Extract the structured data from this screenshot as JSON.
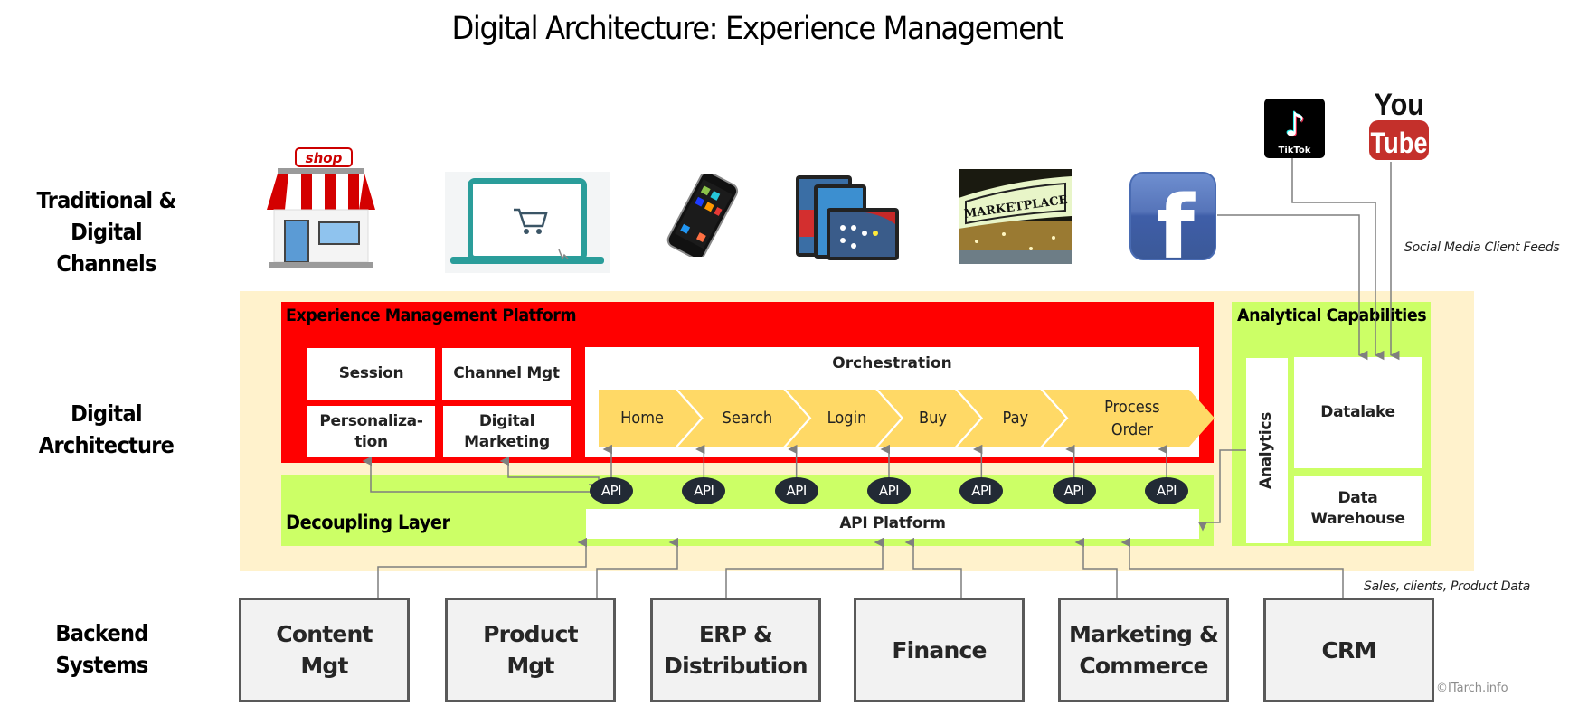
{
  "title": "Digital Architecture: Experience Management",
  "row_labels": {
    "channels": [
      "Traditional &",
      "Digital Channels"
    ],
    "architecture": [
      "Digital",
      "Architecture"
    ],
    "backend": [
      "Backend",
      "Systems"
    ]
  },
  "channels": [
    {
      "name": "store",
      "icon": "shop-storefront-icon",
      "sign": "shop"
    },
    {
      "name": "ecommerce",
      "icon": "laptop-shopping-cart-icon"
    },
    {
      "name": "mobile",
      "icon": "smartphone-icon"
    },
    {
      "name": "tablets",
      "icon": "tablet-devices-icon"
    },
    {
      "name": "marketplace",
      "icon": "marketplace-sign-icon",
      "sign": "MARKETPLACE"
    },
    {
      "name": "facebook",
      "icon": "facebook-icon",
      "glyph": "f"
    },
    {
      "name": "tiktok",
      "icon": "tiktok-icon",
      "label": "TikTok"
    },
    {
      "name": "youtube",
      "icon": "youtube-icon",
      "label_top": "You",
      "label_bottom": "Tube"
    }
  ],
  "social_feeds_note": "Social Media Client Feeds",
  "experience_platform": {
    "title": "Experience Management Platform",
    "modules": {
      "session": "Session",
      "channel_mgt": "Channel Mgt",
      "personalization": [
        "Personaliza-",
        "tion"
      ],
      "digital_marketing": [
        "Digital",
        "Marketing"
      ]
    },
    "orchestration": {
      "title": "Orchestration",
      "steps": [
        {
          "label": [
            "Home"
          ]
        },
        {
          "label": [
            "Search"
          ]
        },
        {
          "label": [
            "Login"
          ]
        },
        {
          "label": [
            "Buy"
          ]
        },
        {
          "label": [
            "Pay"
          ]
        },
        {
          "label": [
            "Process",
            "Order"
          ]
        }
      ]
    }
  },
  "decoupling_layer": {
    "title": "Decoupling Layer",
    "api_label": "API",
    "api_count": 7,
    "api_platform": "API Platform"
  },
  "analytical": {
    "title": "Analytical Capabilities",
    "analytics": "Analytics",
    "datalake": "Datalake",
    "data_warehouse": [
      "Data",
      "Warehouse"
    ]
  },
  "backend_systems": [
    {
      "label": [
        "Content",
        "Mgt"
      ]
    },
    {
      "label": [
        "Product",
        "Mgt"
      ]
    },
    {
      "label": [
        "ERP &",
        "Distribution"
      ]
    },
    {
      "label": [
        "Finance"
      ]
    },
    {
      "label": [
        "Marketing &",
        "Commerce"
      ]
    },
    {
      "label": [
        "CRM"
      ]
    }
  ],
  "backend_note": "Sales, clients, Product Data",
  "copyright": "©ITarch.info",
  "colors": {
    "platform_red": "#ff0000",
    "layer_green": "#ccff66",
    "background_beige": "#fff2cc",
    "chevron_yellow": "#ffd966",
    "api_navy": "#222a35",
    "connector_gray": "#7f7f7f"
  }
}
